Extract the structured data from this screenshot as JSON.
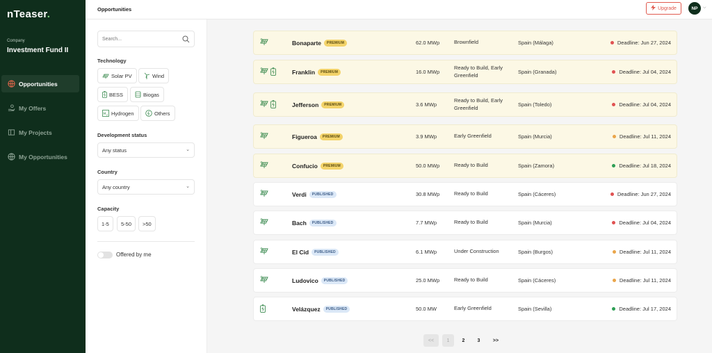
{
  "app": {
    "logo_prefix": "nTeaser",
    "logo_dot": "."
  },
  "sidebar": {
    "company_label": "Company",
    "company_name": "Investment Fund II",
    "items": [
      {
        "label": "Opportunities",
        "icon": "globe-icon"
      },
      {
        "label": "My Offers",
        "icon": "offer-hand-icon"
      },
      {
        "label": "My Projects",
        "icon": "folder-icon"
      },
      {
        "label": "My Opportunities",
        "icon": "globe-icon"
      }
    ]
  },
  "topbar": {
    "title": "Opportunities",
    "upgrade_label": "Upgrade",
    "avatar_initials": "NP"
  },
  "filters": {
    "search_placeholder": "Search...",
    "technology_label": "Technology",
    "technologies": [
      "Solar PV",
      "Wind",
      "BESS",
      "Biogas",
      "Hydrogen",
      "Others"
    ],
    "development_label": "Development status",
    "development_value": "Any status",
    "country_label": "Country",
    "country_value": "Any country",
    "capacity_label": "Capacity",
    "capacities": [
      "1-5",
      "5-50",
      ">50"
    ],
    "offered_by_me_label": "Offered by me",
    "offered_by_me": false
  },
  "opportunities": [
    {
      "name": "Bonaparte",
      "badge": "PREMIUM",
      "tier": "premium",
      "icons": [
        "solar"
      ],
      "capacity": "62.0 MWp",
      "status": "Brownfield",
      "location": "Spain (Málaga)",
      "deadline": "Deadline: Jun 27, 2024",
      "dot": "#e05252"
    },
    {
      "name": "Franklin",
      "badge": "PREMIUM",
      "tier": "premium",
      "icons": [
        "solar",
        "battery"
      ],
      "capacity": "16.0 MWp",
      "status": "Ready to Build, Early Greenfield",
      "location": "Spain (Granada)",
      "deadline": "Deadline: Jul 04, 2024",
      "dot": "#e05252"
    },
    {
      "name": "Jefferson",
      "badge": "PREMIUM",
      "tier": "premium",
      "icons": [
        "solar",
        "battery"
      ],
      "capacity": "3.6 MWp",
      "status": "Ready to Build, Early Greenfield",
      "location": "Spain (Toledo)",
      "deadline": "Deadline: Jul 04, 2024",
      "dot": "#e05252"
    },
    {
      "name": "Figueroa",
      "badge": "PREMIUM",
      "tier": "premium",
      "icons": [
        "solar"
      ],
      "capacity": "3.9 MWp",
      "status": "Early Greenfield",
      "location": "Spain (Murcia)",
      "deadline": "Deadline: Jul 11, 2024",
      "dot": "#eaa54a"
    },
    {
      "name": "Confucio",
      "badge": "PREMIUM",
      "tier": "premium",
      "icons": [
        "solar"
      ],
      "capacity": "50.0 MWp",
      "status": "Ready to Build",
      "location": "Spain (Zamora)",
      "deadline": "Deadline: Jul 18, 2024",
      "dot": "#2e9e55"
    },
    {
      "name": "Verdi",
      "badge": "PUBLISHED",
      "tier": "published",
      "icons": [
        "solar"
      ],
      "capacity": "30.8 MWp",
      "status": "Ready to Build",
      "location": "Spain (Cáceres)",
      "deadline": "Deadline: Jun 27, 2024",
      "dot": "#e05252"
    },
    {
      "name": "Bach",
      "badge": "PUBLISHED",
      "tier": "published",
      "icons": [
        "solar"
      ],
      "capacity": "7.7 MWp",
      "status": "Ready to Build",
      "location": "Spain (Murcia)",
      "deadline": "Deadline: Jul 04, 2024",
      "dot": "#e05252"
    },
    {
      "name": "El Cid",
      "badge": "PUBLISHED",
      "tier": "published",
      "icons": [
        "solar"
      ],
      "capacity": "6.1 MWp",
      "status": "Under Construction",
      "location": "Spain (Burgos)",
      "deadline": "Deadline: Jul 11, 2024",
      "dot": "#eaa54a"
    },
    {
      "name": "Ludovico",
      "badge": "PUBLISHED",
      "tier": "published",
      "icons": [
        "solar"
      ],
      "capacity": "25.0 MWp",
      "status": "Ready to Build",
      "location": "Spain (Cáceres)",
      "deadline": "Deadline: Jul 11, 2024",
      "dot": "#eaa54a"
    },
    {
      "name": "Velázquez",
      "badge": "PUBLISHED",
      "tier": "published",
      "icons": [
        "battery"
      ],
      "capacity": "50.0 MW",
      "status": "Early Greenfield",
      "location": "Spain (Sevilla)",
      "deadline": "Deadline: Jul 17, 2024",
      "dot": "#2e9e55"
    }
  ],
  "pagination": {
    "prev": "<<",
    "pages": [
      "1",
      "2",
      "3"
    ],
    "current": "1",
    "next": ">>"
  },
  "colors": {
    "sidebar_bg": "#0f2e1c",
    "accent": "#e05a4f",
    "premium_bg": "#fcf8e5",
    "premium_badge": "#f3d36a",
    "published_badge": "#dbe8f7"
  }
}
